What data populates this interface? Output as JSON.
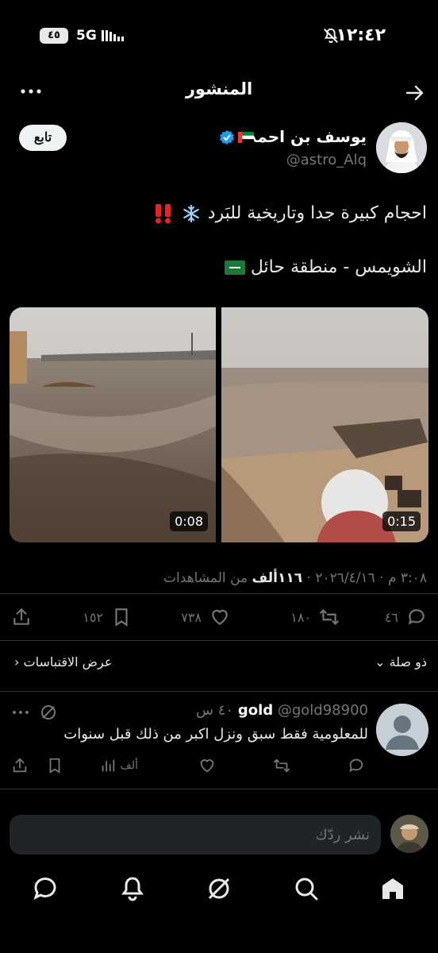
{
  "status_bar": {
    "time": "١٢:٤٢",
    "battery": "٤٥",
    "network": "5G",
    "icons": [
      "mute-icon",
      "signal-icon"
    ]
  },
  "header": {
    "title": "المنشور",
    "icons": [
      "back-arrow-icon",
      "more-icon"
    ]
  },
  "author": {
    "name": "يوسف بن احمد",
    "handle": "@astro_Alq",
    "follow_label": "تابع",
    "badges": [
      "verified-icon",
      "uae-flag-icon"
    ]
  },
  "tweet": {
    "line1": "احجام كبيرة جدا وتاريخية للبَرد",
    "line2": "الشويمس - منطقة حائل",
    "emoji": [
      "snowflake-icon",
      "double-exclamation-icon",
      "saudi-flag-icon"
    ],
    "videos": [
      {
        "duration": "0:08"
      },
      {
        "duration": "0:15"
      }
    ],
    "timestamp": "٣:٠٨ م · ٢٠٢٦/٤/١٦ ·",
    "views_count": "١١٦ألف",
    "views_label": "من المشاهدات"
  },
  "actions": {
    "replies": "٤٦",
    "reposts": "١٨٠",
    "likes": "٧٣٨",
    "bookmarks": "١٥٢"
  },
  "sort": {
    "relevance_label": "ذو صلة",
    "quotes_label": "عرض الاقتباسات"
  },
  "reply": {
    "name": "gold",
    "handle": "@gold98900",
    "time": "٤٠ س",
    "text": "للمعلومية فقط سبق ونزل اكبر من ذلك قبل سنوات",
    "views": "ألف"
  },
  "compose": {
    "placeholder": "نشر ردّك"
  },
  "nav": [
    "home-icon",
    "search-icon",
    "grok-icon",
    "notifications-icon",
    "messages-icon"
  ],
  "colors": {
    "background": "#000000",
    "text": "#e7e9ea",
    "muted": "#71767b",
    "verified": "#1d9bf0",
    "divider": "#2f3336"
  }
}
